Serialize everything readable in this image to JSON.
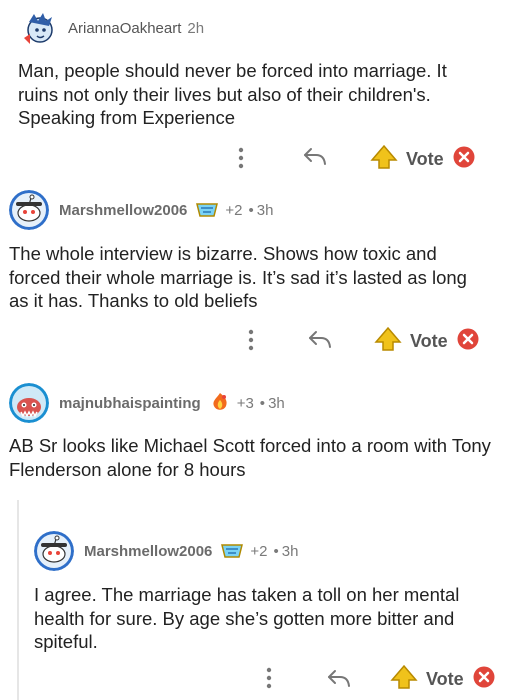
{
  "comments": [
    {
      "username": "AriannaOakheart",
      "time": "2h",
      "score": "",
      "text": "Man, people should never be forced into marriage. It ruins not only their lives but also of their children's. Speaking from Experience",
      "vote_label": "Vote"
    },
    {
      "username": "Marshmellow2006",
      "time": "3h",
      "score": "+2",
      "text": "The whole interview is bizarre. Shows how toxic and forced their whole marriage is. It’s sad it’s lasted as long as it has. Thanks to old beliefs",
      "vote_label": "Vote"
    },
    {
      "username": "majnubhaispainting",
      "time": "3h",
      "score": "+3",
      "text": "AB Sr looks like Michael Scott forced into a room with Tony Flenderson alone for 8 hours",
      "vote_label": ""
    },
    {
      "username": "Marshmellow2006",
      "time": "3h",
      "score": "+2",
      "text": "I agree. The marriage has taken a toll on her mental health for sure. By age she’s gotten more bitter and spiteful.",
      "vote_label": "Vote"
    }
  ],
  "separator": "•",
  "colors": {
    "username": "#6b6b6b",
    "meta": "#7a7a7a",
    "text": "#222222",
    "downvote": "#e0453a",
    "upvote": "#f0c21b"
  }
}
